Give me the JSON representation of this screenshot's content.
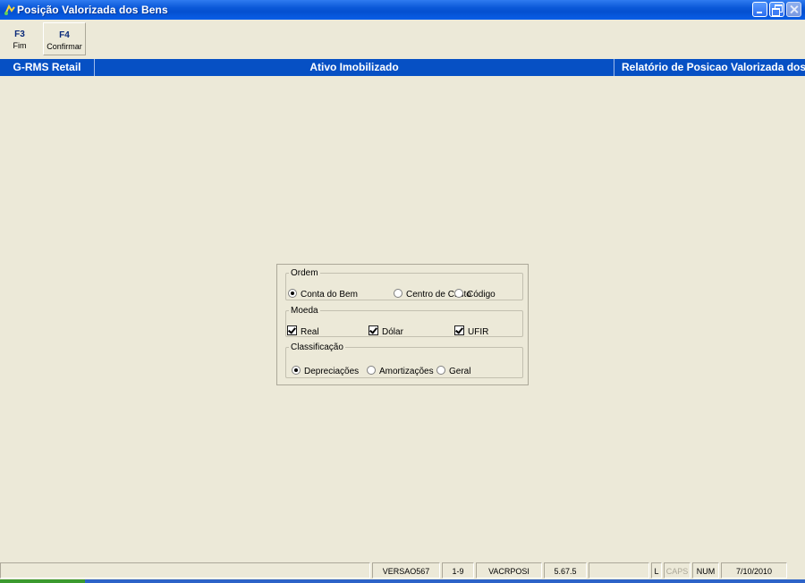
{
  "window": {
    "title": "Posição Valorizada dos Bens"
  },
  "toolbar": {
    "f3": {
      "key": "F3",
      "label": "Fim"
    },
    "f4": {
      "key": "F4",
      "label": "Confirmar"
    }
  },
  "header": {
    "app": "G-RMS Retail",
    "module": "Ativo Imobilizado",
    "report": "Relatório de Posicao Valorizada dos"
  },
  "form": {
    "ordem": {
      "legend": "Ordem",
      "options": [
        "Conta do Bem",
        "Centro de Custo",
        "Código"
      ],
      "selected": "Conta do Bem"
    },
    "moeda": {
      "legend": "Moeda",
      "options": [
        {
          "label": "Real",
          "checked": true
        },
        {
          "label": "Dólar",
          "checked": true
        },
        {
          "label": "UFIR",
          "checked": true
        }
      ]
    },
    "classificacao": {
      "legend": "Classificação",
      "options": [
        "Depreciações",
        "Amortizações",
        "Geral"
      ],
      "selected": "Depreciações"
    }
  },
  "statusbar": {
    "version": "VERSAO567",
    "range": "1-9",
    "program": "VACRPOSI",
    "build": "5.67.5",
    "mode": "L",
    "caps": "CAPS",
    "num": "NUM",
    "date": "7/10/2010"
  },
  "colors": {
    "titlebar": "#0a58d8",
    "header_band": "#0650c4",
    "window_bg": "#ece9d8"
  }
}
